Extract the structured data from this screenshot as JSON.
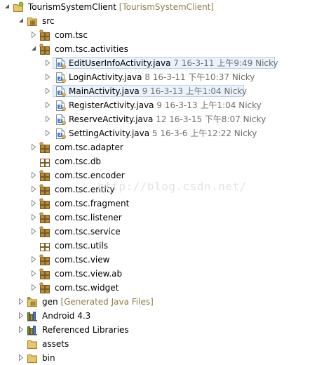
{
  "colors": {
    "package": "#b68b39",
    "package_dark": "#7a5a1e",
    "java_file": "#4a80c7",
    "folder": "#e9c46a",
    "decoration": "#8e7d4b",
    "meta_text": "#6f6f6f",
    "selection_border": "#b8d4f0",
    "selection_fill": "#eaf3fc"
  },
  "watermark": "http://blog.csdn.net/",
  "tree": {
    "project": {
      "label": "TourismSystemClient",
      "decoration": "[TourismSystemClient]",
      "icon": "android-project-icon"
    },
    "src": {
      "label": "src",
      "icon": "source-folder-icon"
    },
    "packages": [
      {
        "label": "com.tsc",
        "icon": "package-icon"
      },
      {
        "label": "com.tsc.activities",
        "icon": "package-icon"
      },
      {
        "label": "com.tsc.adapter",
        "icon": "package-icon"
      },
      {
        "label": "com.tsc.db",
        "icon": "package-empty-icon"
      },
      {
        "label": "com.tsc.encoder",
        "icon": "package-icon"
      },
      {
        "label": "com.tsc.entity",
        "icon": "package-icon"
      },
      {
        "label": "com.tsc.fragment",
        "icon": "package-icon"
      },
      {
        "label": "com.tsc.listener",
        "icon": "package-icon"
      },
      {
        "label": "com.tsc.service",
        "icon": "package-icon"
      },
      {
        "label": "com.tsc.utils",
        "icon": "package-empty-icon"
      },
      {
        "label": "com.tsc.view",
        "icon": "package-icon"
      },
      {
        "label": "com.tsc.view.ab",
        "icon": "package-icon"
      },
      {
        "label": "com.tsc.widget",
        "icon": "package-icon"
      }
    ],
    "files": [
      {
        "name": "EditUserInfoActivity.java",
        "meta": "7  16-3-11 上午9:49  Nicky",
        "icon": "java-file-icon"
      },
      {
        "name": "LoginActivity.java",
        "meta": "8  16-3-11 下午10:37  Nicky",
        "icon": "java-file-icon"
      },
      {
        "name": "MainActivity.java",
        "meta": "9  16-3-13 上午1:04  Nicky",
        "icon": "java-file-icon"
      },
      {
        "name": "RegisterActivity.java",
        "meta": "9  16-3-13 上午1:04  Nicky",
        "icon": "java-file-icon"
      },
      {
        "name": "ReserveActivity.java",
        "meta": "12  16-3-15 下午8:07  Nicky",
        "icon": "java-file-icon"
      },
      {
        "name": "SettingActivity.java",
        "meta": "5  16-3-6 上午12:22  Nicky",
        "icon": "java-file-icon"
      }
    ],
    "gen": {
      "label": "gen",
      "decoration": "[Generated Java Files]",
      "icon": "generated-folder-icon"
    },
    "android": {
      "label": "Android 4.3",
      "icon": "library-icon"
    },
    "referenced": {
      "label": "Referenced Libraries",
      "icon": "library-icon"
    },
    "assets": {
      "label": "assets",
      "icon": "folder-icon"
    },
    "bin": {
      "label": "bin",
      "icon": "folder-icon"
    }
  }
}
